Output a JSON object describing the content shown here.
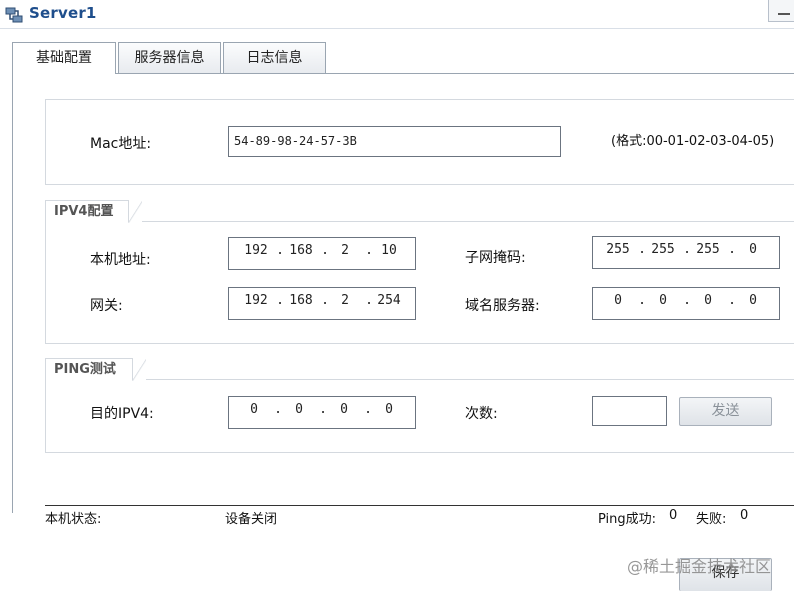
{
  "window": {
    "title": "Server1"
  },
  "tabs": [
    {
      "label": "基础配置"
    },
    {
      "label": "服务器信息"
    },
    {
      "label": "日志信息"
    }
  ],
  "mac": {
    "label": "Mac地址:",
    "value": "54-89-98-24-57-3B",
    "hint": "(格式:00-01-02-03-04-05)"
  },
  "ipv4": {
    "section_title": "IPV4配置",
    "local_label": "本机地址:",
    "local": [
      "192",
      "168",
      "2",
      "10"
    ],
    "mask_label": "子网掩码:",
    "mask": [
      "255",
      "255",
      "255",
      "0"
    ],
    "gateway_label": "网关:",
    "gateway": [
      "192",
      "168",
      "2",
      "254"
    ],
    "dns_label": "域名服务器:",
    "dns": [
      "0",
      "0",
      "0",
      "0"
    ]
  },
  "ping": {
    "section_title": "PING测试",
    "target_label": "目的IPV4:",
    "target": [
      "0",
      "0",
      "0",
      "0"
    ],
    "count_label": "次数:",
    "count_value": "",
    "send_label": "发送"
  },
  "status": {
    "state_label": "本机状态:",
    "state_value": "设备关闭",
    "ping_success_label": "Ping成功:",
    "ping_success": "0",
    "ping_fail_label": "失败:",
    "ping_fail": "0"
  },
  "save_label": "保存",
  "watermark": "@稀土掘金技术社区"
}
